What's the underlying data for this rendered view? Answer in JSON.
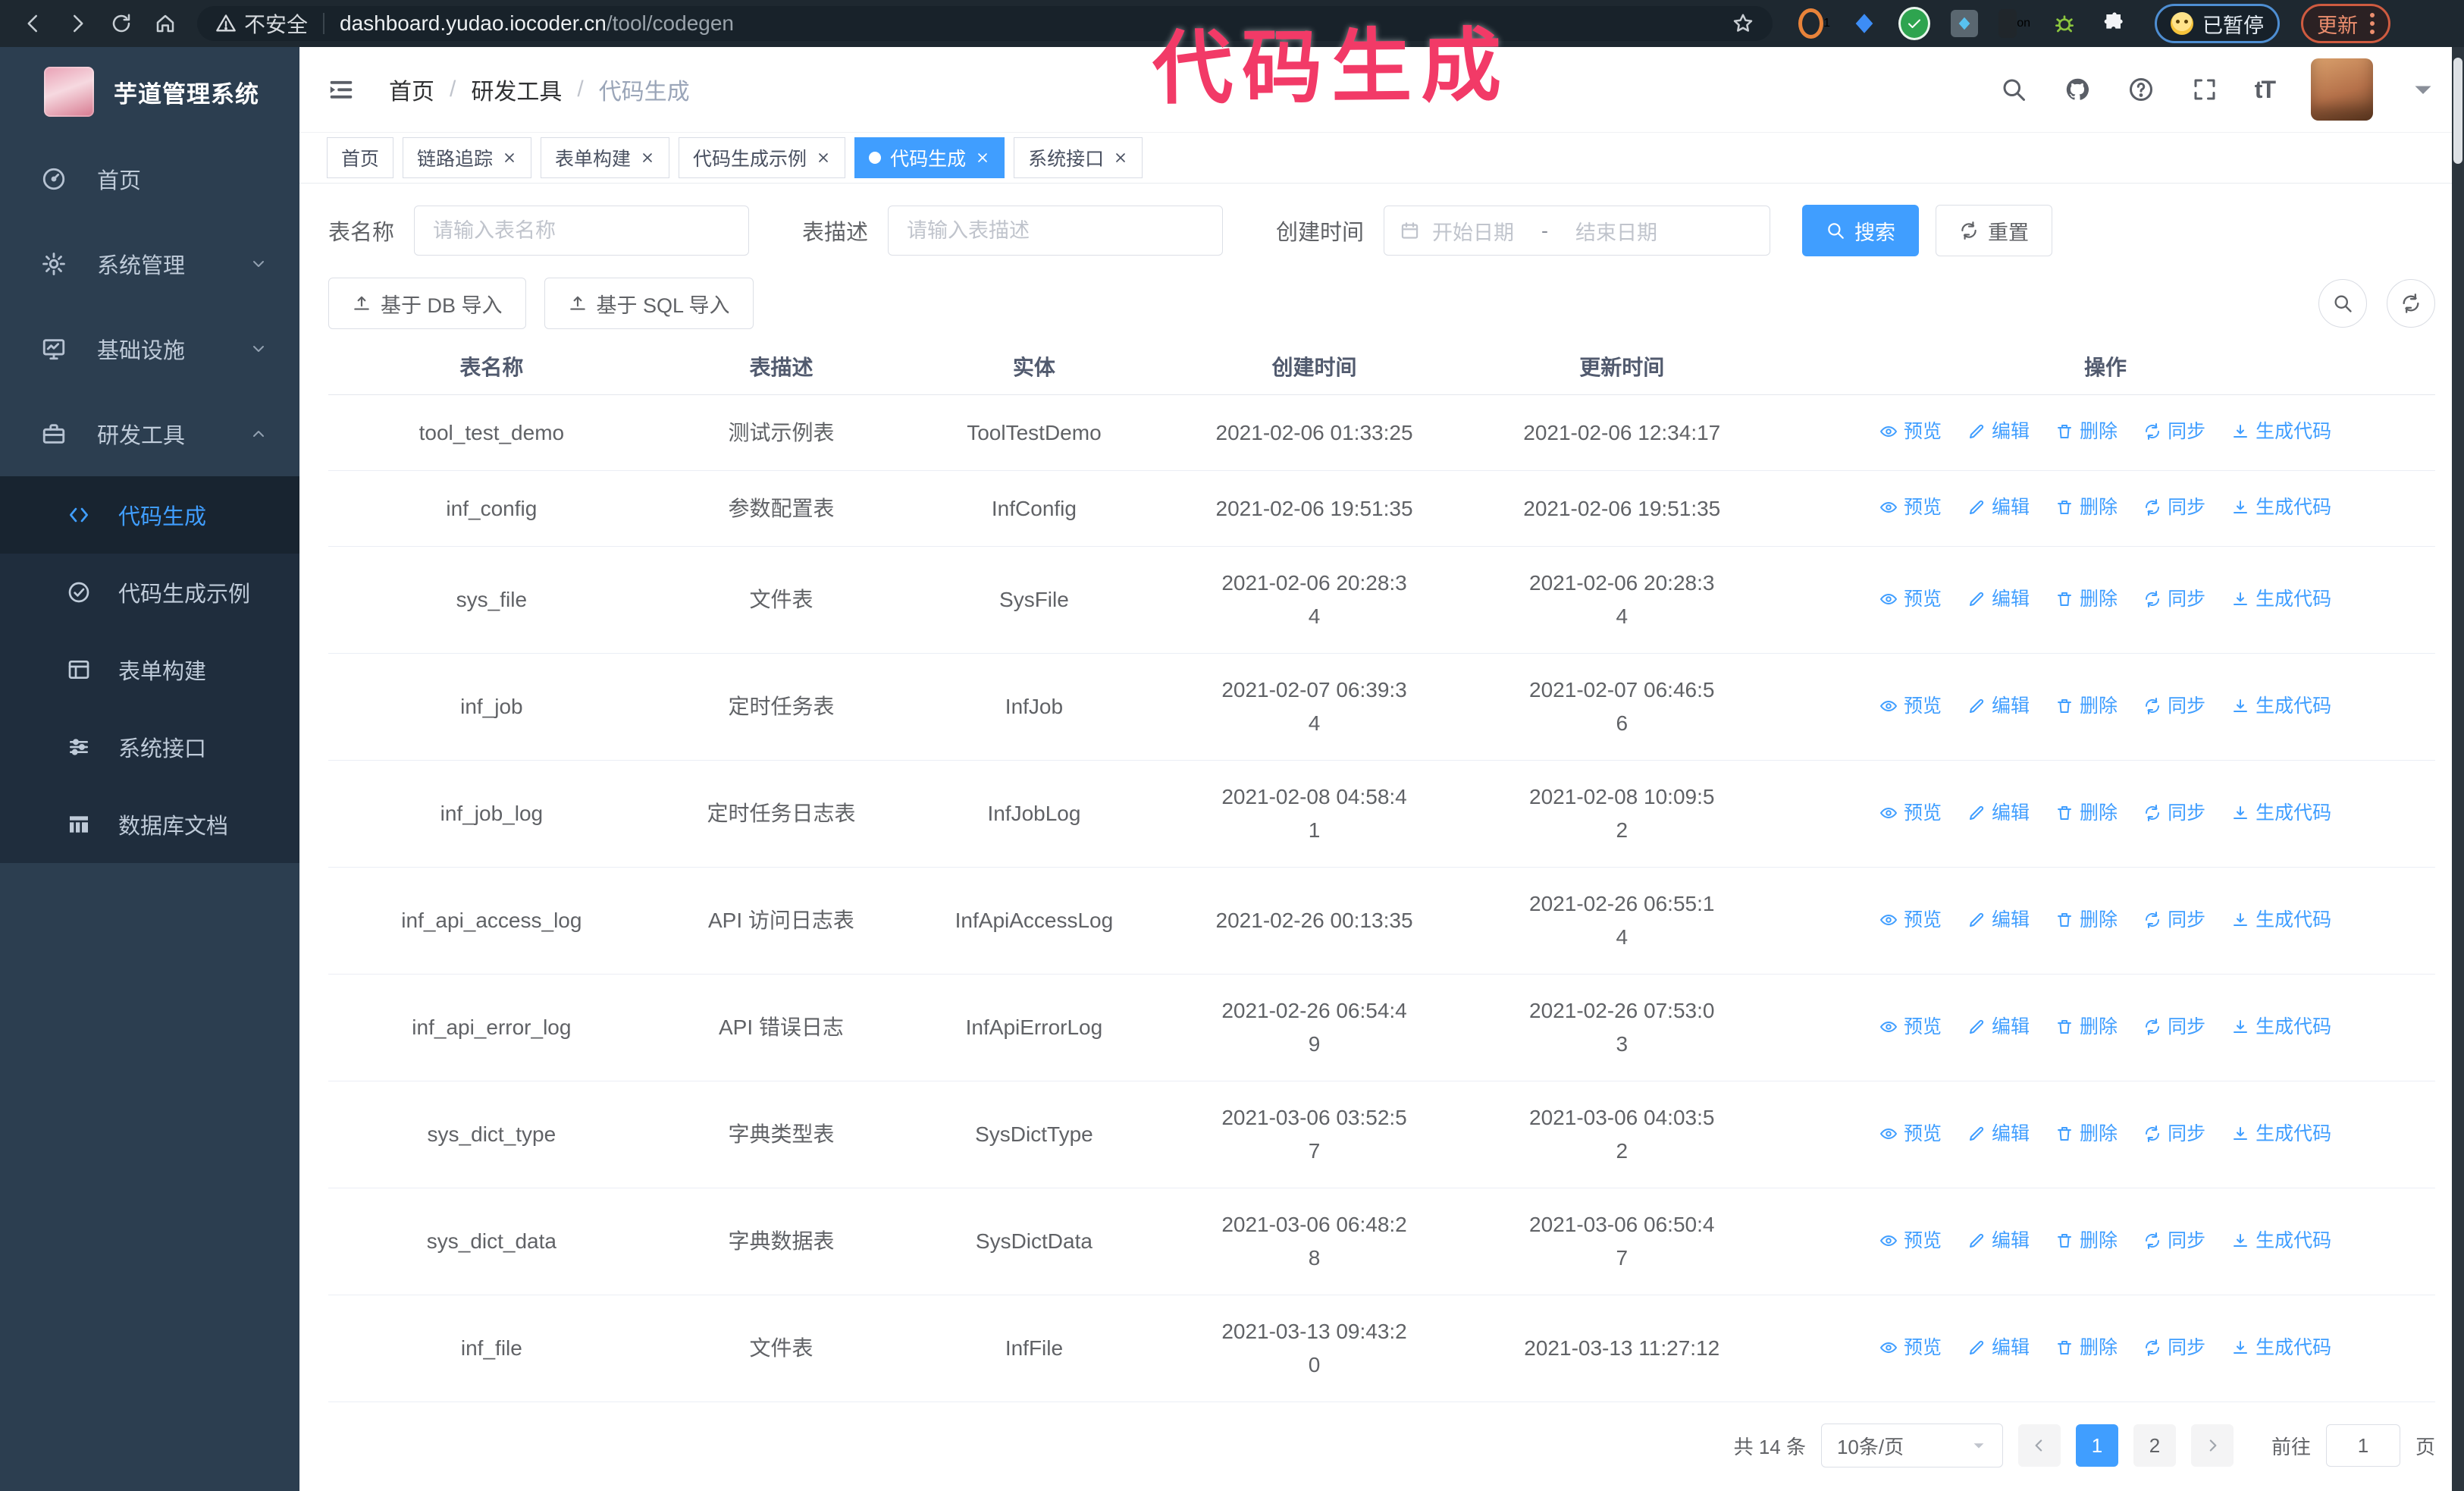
{
  "annotation": {
    "text": "代码生成",
    "color": "#f23a67"
  },
  "browser": {
    "insecure_label": "不安全",
    "url_host": "dashboard.yudao.iocoder.cn",
    "url_path": "/tool/codegen",
    "extension_badge_1": "1",
    "extension_badge_on": "on",
    "paused_label": "已暂停",
    "update_label": "更新"
  },
  "sidebar": {
    "app_title": "芋道管理系统",
    "items": [
      {
        "label": "首页",
        "icon": "dashboard",
        "expandable": false,
        "expanded": false
      },
      {
        "label": "系统管理",
        "icon": "gear",
        "expandable": true,
        "expanded": false
      },
      {
        "label": "基础设施",
        "icon": "monitor",
        "expandable": true,
        "expanded": false
      },
      {
        "label": "研发工具",
        "icon": "toolbox",
        "expandable": true,
        "expanded": true
      }
    ],
    "submenu": [
      {
        "label": "代码生成",
        "icon": "code",
        "active": true
      },
      {
        "label": "代码生成示例",
        "icon": "check-badge",
        "active": false
      },
      {
        "label": "表单构建",
        "icon": "form",
        "active": false
      },
      {
        "label": "系统接口",
        "icon": "sliders",
        "active": false
      },
      {
        "label": "数据库文档",
        "icon": "dbgrid",
        "active": false
      }
    ]
  },
  "header": {
    "breadcrumb": [
      "首页",
      "研发工具",
      "代码生成"
    ]
  },
  "tabs": [
    {
      "label": "首页",
      "closable": false,
      "active": false
    },
    {
      "label": "链路追踪",
      "closable": true,
      "active": false
    },
    {
      "label": "表单构建",
      "closable": true,
      "active": false
    },
    {
      "label": "代码生成示例",
      "closable": true,
      "active": false
    },
    {
      "label": "代码生成",
      "closable": true,
      "active": true
    },
    {
      "label": "系统接口",
      "closable": true,
      "active": false
    }
  ],
  "filters": {
    "table_name_label": "表名称",
    "table_name_placeholder": "请输入表名称",
    "table_desc_label": "表描述",
    "table_desc_placeholder": "请输入表描述",
    "create_time_label": "创建时间",
    "date_start_placeholder": "开始日期",
    "date_separator": "-",
    "date_end_placeholder": "结束日期",
    "search_label": "搜索",
    "reset_label": "重置"
  },
  "toolbar": {
    "import_db_label": "基于 DB 导入",
    "import_sql_label": "基于 SQL 导入"
  },
  "table": {
    "columns": [
      "表名称",
      "表描述",
      "实体",
      "创建时间",
      "更新时间",
      "操作"
    ],
    "actions": [
      "预览",
      "编辑",
      "删除",
      "同步",
      "生成代码"
    ],
    "rows": [
      {
        "name": "tool_test_demo",
        "desc": "测试示例表",
        "entity": "ToolTestDemo",
        "created": "2021-02-06 01:33:25",
        "updated": "2021-02-06 12:34:17"
      },
      {
        "name": "inf_config",
        "desc": "参数配置表",
        "entity": "InfConfig",
        "created": "2021-02-06 19:51:35",
        "updated": "2021-02-06 19:51:35"
      },
      {
        "name": "sys_file",
        "desc": "文件表",
        "entity": "SysFile",
        "created": "2021-02-06 20:28:3\n4",
        "updated": "2021-02-06 20:28:3\n4"
      },
      {
        "name": "inf_job",
        "desc": "定时任务表",
        "entity": "InfJob",
        "created": "2021-02-07 06:39:3\n4",
        "updated": "2021-02-07 06:46:5\n6"
      },
      {
        "name": "inf_job_log",
        "desc": "定时任务日志表",
        "entity": "InfJobLog",
        "created": "2021-02-08 04:58:4\n1",
        "updated": "2021-02-08 10:09:5\n2"
      },
      {
        "name": "inf_api_access_log",
        "desc": "API 访问日志表",
        "entity": "InfApiAccessLog",
        "created": "2021-02-26 00:13:35",
        "updated": "2021-02-26 06:55:1\n4"
      },
      {
        "name": "inf_api_error_log",
        "desc": "API 错误日志",
        "entity": "InfApiErrorLog",
        "created": "2021-02-26 06:54:4\n9",
        "updated": "2021-02-26 07:53:0\n3"
      },
      {
        "name": "sys_dict_type",
        "desc": "字典类型表",
        "entity": "SysDictType",
        "created": "2021-03-06 03:52:5\n7",
        "updated": "2021-03-06 04:03:5\n2"
      },
      {
        "name": "sys_dict_data",
        "desc": "字典数据表",
        "entity": "SysDictData",
        "created": "2021-03-06 06:48:2\n8",
        "updated": "2021-03-06 06:50:4\n7"
      },
      {
        "name": "inf_file",
        "desc": "文件表",
        "entity": "InfFile",
        "created": "2021-03-13 09:43:2\n0",
        "updated": "2021-03-13 11:27:12"
      }
    ]
  },
  "pagination": {
    "total_label": "共 14 条",
    "page_size_label": "10条/页",
    "pages": [
      "1",
      "2"
    ],
    "active_page": "1",
    "goto_label": "前往",
    "goto_value": "1",
    "page_suffix_label": "页"
  }
}
